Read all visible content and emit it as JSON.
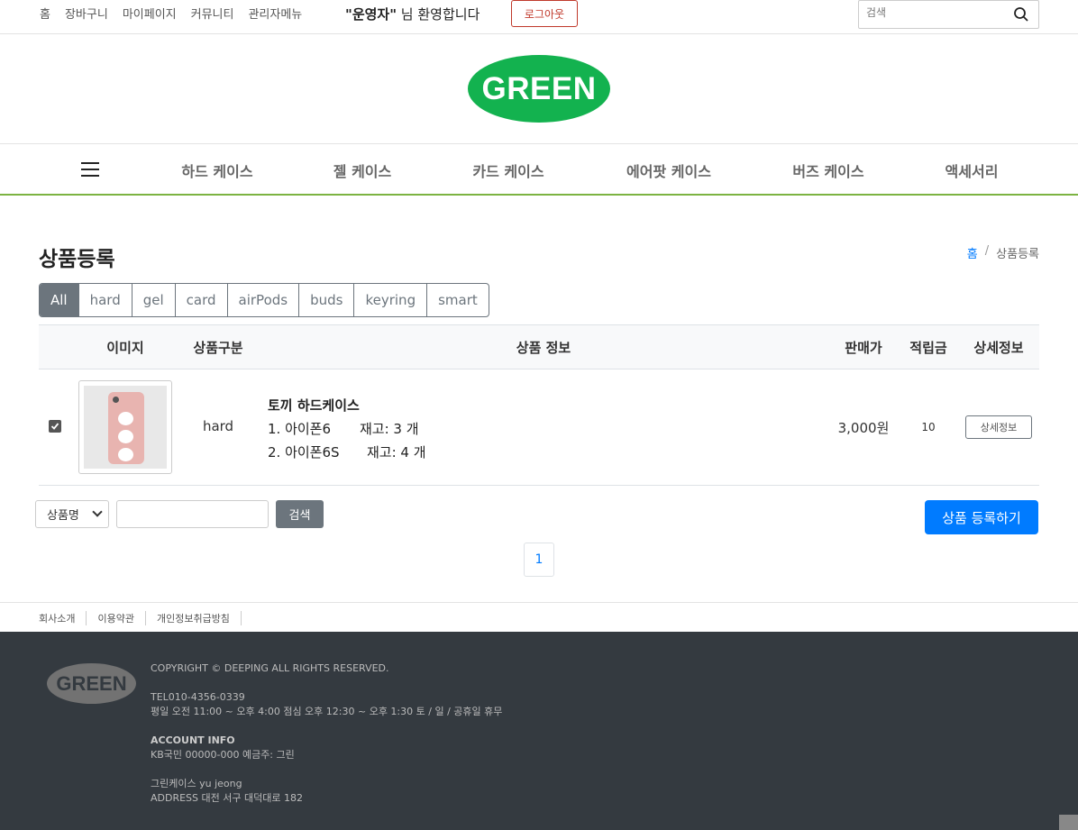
{
  "topbar": {
    "nav": [
      "홈",
      "장바구니",
      "마이페이지",
      "커뮤니티",
      "관리자메뉴"
    ],
    "welcome_user": "\"운영자\"",
    "welcome_suffix": " 님 환영합니다",
    "logout_label": "로그아웃",
    "search_placeholder": "검색"
  },
  "logo_text": "GREEN",
  "categories": [
    "하드 케이스",
    "젤 케이스",
    "카드 케이스",
    "에어팟 케이스",
    "버즈 케이스",
    "액세서리"
  ],
  "page": {
    "title": "상품등록",
    "breadcrumb_home": "홈",
    "breadcrumb_sep": "/",
    "breadcrumb_current": "상품등록"
  },
  "filters": [
    "All",
    "hard",
    "gel",
    "card",
    "airPods",
    "buds",
    "keyring",
    "smart"
  ],
  "table": {
    "headers": [
      "이미지",
      "상품구분",
      "상품 정보",
      "판매가",
      "적립금",
      "상세정보"
    ],
    "rows": [
      {
        "checked": true,
        "type": "hard",
        "name": "토끼 하드케이스",
        "options": [
          {
            "model": "1. 아이폰6",
            "stock": "재고: 3 개"
          },
          {
            "model": "2. 아이폰6S",
            "stock": "재고: 4 개"
          }
        ],
        "price": "3,000원",
        "point": "10",
        "detail_label": "상세정보"
      }
    ]
  },
  "search": {
    "select_value": "상품명",
    "button_label": "검색"
  },
  "register_label": "상품 등록하기",
  "pagination": [
    "1"
  ],
  "footer_links": [
    "회사소개",
    "이용약관",
    "개인정보취급방침"
  ],
  "footer": {
    "logo": "GREEN",
    "copyright": "COPYRIGHT © DEEPING ALL RIGHTS RESERVED.",
    "tel": "TEL010-4356-0339",
    "hours": "평일 오전 11:00 ~ 오후 4:00 점심 오후 12:30 ~ 오후 1:30 토 / 일 / 공휴일 휴무",
    "account_title": "ACCOUNT INFO",
    "account": "KB국민 00000-000 예금주: 그린",
    "company": "그린케이스 yu jeong",
    "address": "ADDRESS 대전 서구 대덕대로 182"
  },
  "colors": {
    "brand_green": "#13b24f",
    "nav_underline": "#7cb342",
    "primary_blue": "#007bff",
    "secondary_gray": "#6c757d",
    "footer_bg": "#343a40",
    "logout_red": "#c0392b"
  }
}
